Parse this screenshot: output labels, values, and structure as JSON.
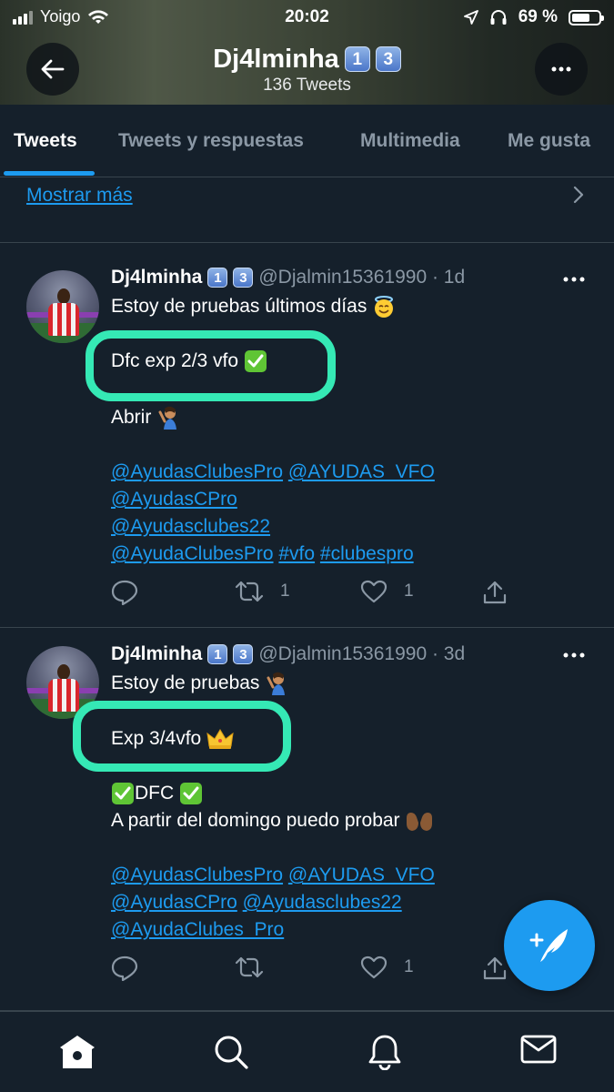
{
  "status_bar": {
    "carrier": "Yoigo",
    "time": "20:02",
    "battery": "69 %",
    "battery_level": 0.69
  },
  "header": {
    "name": "Dj4lminha",
    "badges": [
      "1",
      "3"
    ],
    "subtitle": "136 Tweets"
  },
  "tabs": [
    {
      "label": "Tweets",
      "active": true
    },
    {
      "label": "Tweets y respuestas",
      "active": false
    },
    {
      "label": "Multimedia",
      "active": false
    },
    {
      "label": "Me gusta",
      "active": false
    }
  ],
  "show_more": "Mostrar más",
  "tweets": [
    {
      "name": "Dj4lminha",
      "handle": "@Djalmin15361990 · 1d",
      "lines": {
        "l1": "Estoy de pruebas últimos días",
        "l2": "Dfc exp 2/3 vfo",
        "l3": "Abrir"
      },
      "mentions": [
        "@AyudasClubesPro",
        "@AYUDAS_VFO",
        "@AyudasCPro",
        "@Ayudasclubes22",
        "@AyudaClubesPro",
        "#vfo",
        "#clubespro"
      ],
      "retweets": "1",
      "likes": "1"
    },
    {
      "name": "Dj4lminha",
      "handle": "@Djalmin15361990 · 3d",
      "lines": {
        "l1": "Estoy de pruebas",
        "l2": "Exp 3/4vfo",
        "l3": "DFC",
        "l4": "A partir del domingo puedo probar"
      },
      "mentions": [
        "@AyudasClubesPro",
        "@AYUDAS_VFO",
        "@AyudasCPro",
        "@Ayudasclubes22",
        "@AyudaClubes_Pro"
      ],
      "retweets": "",
      "likes": "1"
    }
  ],
  "colors": {
    "background": "#15202b",
    "accent": "#1d9bf0",
    "highlight": "#35e9b5",
    "muted": "#8b98a5"
  },
  "icons": {
    "back": "arrow-left-icon",
    "more": "more-horizontal-icon",
    "compose": "feather-plus-icon",
    "nav": [
      "home-icon",
      "search-icon",
      "bell-icon",
      "mail-icon"
    ]
  }
}
